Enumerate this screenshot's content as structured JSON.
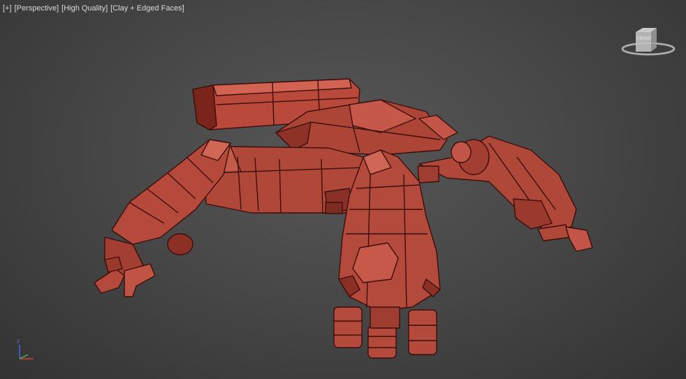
{
  "viewport": {
    "labels": [
      "[+]",
      "[Perspective]",
      "[High Quality]",
      "[Clay + Edged Faces]"
    ]
  },
  "viewcube": {
    "face_label": "FRONT"
  },
  "axis": {
    "z_label": "z"
  },
  "colors": {
    "model_fill": "#b24a3c",
    "model_edge": "#3a0e0a",
    "background": "#484848"
  }
}
